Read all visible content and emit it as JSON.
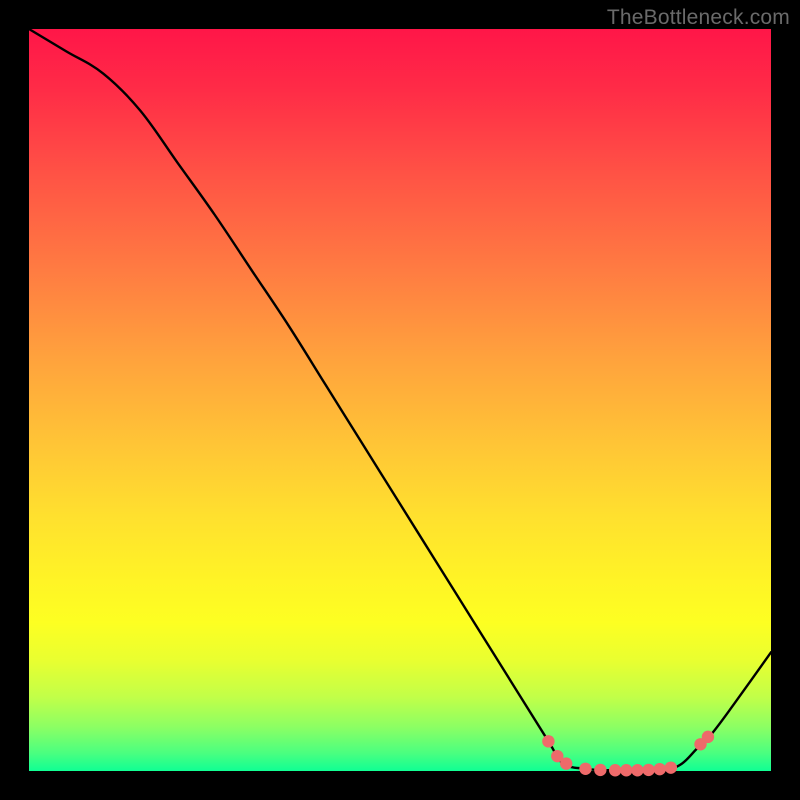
{
  "watermark": "TheBottleneck.com",
  "chart_data": {
    "type": "line",
    "title": "",
    "xlabel": "",
    "ylabel": "",
    "xlim": [
      0,
      100
    ],
    "ylim": [
      0,
      100
    ],
    "series": [
      {
        "name": "bottleneck-curve",
        "x": [
          0,
          5,
          10,
          15,
          20,
          25,
          30,
          35,
          40,
          45,
          50,
          55,
          60,
          65,
          70,
          72,
          75,
          78,
          82,
          86,
          88,
          90,
          92,
          95,
          100
        ],
        "y": [
          100,
          97,
          94,
          89,
          82,
          75,
          67.5,
          60,
          52,
          44,
          36,
          28,
          20,
          12,
          4,
          1,
          0.3,
          0.1,
          0.1,
          0.3,
          1,
          3,
          5,
          9,
          16
        ]
      }
    ],
    "markers": {
      "name": "highlight-dots",
      "color": "#ee6a6a",
      "points": [
        {
          "x": 70.0,
          "y": 4.0
        },
        {
          "x": 71.2,
          "y": 2.0
        },
        {
          "x": 72.4,
          "y": 1.0
        },
        {
          "x": 75.0,
          "y": 0.3
        },
        {
          "x": 77.0,
          "y": 0.15
        },
        {
          "x": 79.0,
          "y": 0.1
        },
        {
          "x": 80.5,
          "y": 0.1
        },
        {
          "x": 82.0,
          "y": 0.1
        },
        {
          "x": 83.5,
          "y": 0.15
        },
        {
          "x": 85.0,
          "y": 0.25
        },
        {
          "x": 86.5,
          "y": 0.45
        },
        {
          "x": 90.5,
          "y": 3.6
        },
        {
          "x": 91.5,
          "y": 4.6
        }
      ]
    }
  }
}
